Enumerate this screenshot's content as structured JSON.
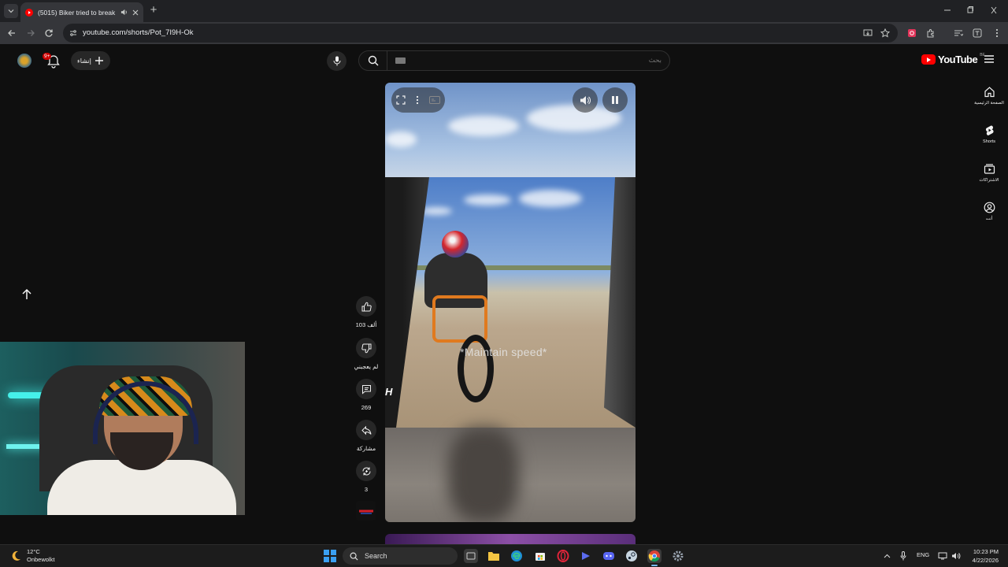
{
  "browser": {
    "tab_title": "(5015) Biker tried to break a",
    "url": "youtube.com/shorts/Pot_7I9H-Ok"
  },
  "youtube": {
    "logo_text": "YouTube",
    "country_code": "BE",
    "search_placeholder": "بحث",
    "create_label": "إنشاء",
    "notification_count": "9+",
    "sidebar": [
      {
        "label": "الصفحة الرئيسية",
        "icon": "home-icon"
      },
      {
        "label": "Shorts",
        "icon": "shorts-icon"
      },
      {
        "label": "الاشتراكات",
        "icon": "subscriptions-icon"
      },
      {
        "label": "أنت",
        "icon": "you-icon"
      }
    ],
    "short": {
      "caption": "*Maintain speed*",
      "overlay_logo_fragment": "H"
    },
    "actions": {
      "likes": "103 ألف",
      "dislike_label": "لم يعجبني",
      "comments": "269",
      "share_label": "مشاركة",
      "remix_count": "3"
    }
  },
  "taskbar": {
    "temperature": "12°C",
    "weather_desc": "Onbewolkt",
    "search_label": "Search",
    "language": "ENG",
    "time": "10:23 PM",
    "date": "4/22/2026"
  },
  "colors": {
    "yt_red": "#ff0000",
    "background": "#0f0f0f",
    "accent_blue": "#3aa0f3"
  }
}
